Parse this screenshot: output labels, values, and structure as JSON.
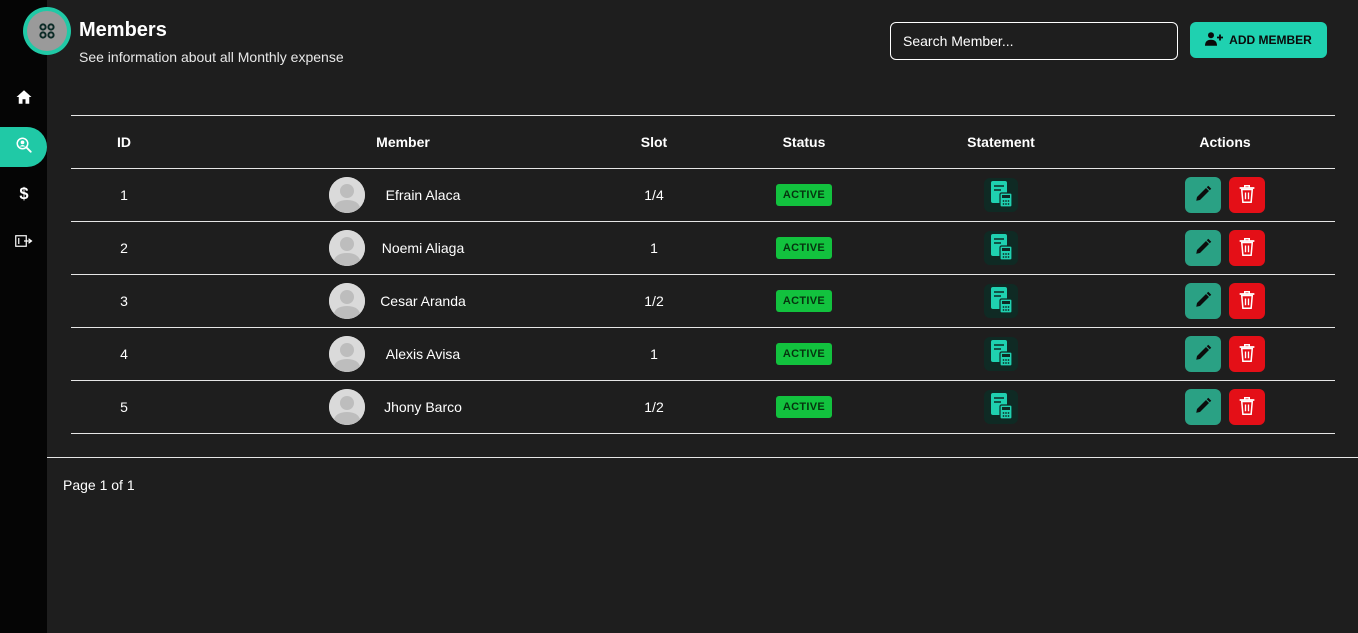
{
  "header": {
    "title": "Members",
    "subtitle": "See information about all Monthly expense"
  },
  "search": {
    "placeholder": "Search Member..."
  },
  "add_button": {
    "label": "ADD MEMBER"
  },
  "colors": {
    "accent": "#20c9a6",
    "active_badge": "#12c23e",
    "edit": "#2aa184",
    "delete": "#e40f17",
    "background": "#1e1e1e",
    "sidebar": "#050505"
  },
  "sidebar": {
    "items": [
      {
        "icon": "home-icon",
        "active": false
      },
      {
        "icon": "user-search-icon",
        "active": true
      },
      {
        "icon": "dollar-icon",
        "active": false
      },
      {
        "icon": "logout-icon",
        "active": false
      }
    ]
  },
  "table": {
    "columns": [
      "ID",
      "Member",
      "Slot",
      "Status",
      "Statement",
      "Actions"
    ],
    "rows": [
      {
        "id": "1",
        "member": "Efrain Alaca",
        "slot": "1/4",
        "status": "ACTIVE"
      },
      {
        "id": "2",
        "member": "Noemi Aliaga",
        "slot": "1",
        "status": "ACTIVE"
      },
      {
        "id": "3",
        "member": "Cesar Aranda",
        "slot": "1/2",
        "status": "ACTIVE"
      },
      {
        "id": "4",
        "member": "Alexis Avisa",
        "slot": "1",
        "status": "ACTIVE"
      },
      {
        "id": "5",
        "member": "Jhony Barco",
        "slot": "1/2",
        "status": "ACTIVE"
      }
    ]
  },
  "pagination": {
    "label": "Page 1 of 1"
  }
}
